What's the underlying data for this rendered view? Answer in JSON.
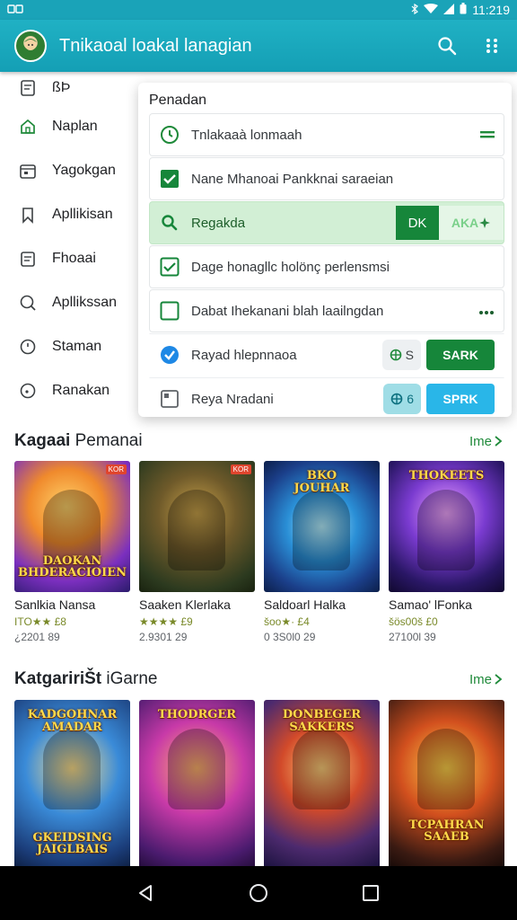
{
  "status_bar": {
    "time": "11:219"
  },
  "app_bar": {
    "title": "Tnikaoal loakal lanagian"
  },
  "side_menu": [
    {
      "label": "ßÞ",
      "icon": "document-icon"
    },
    {
      "label": "Naplan",
      "icon": "home-icon"
    },
    {
      "label": "Yagokgan",
      "icon": "calendar-icon"
    },
    {
      "label": "Apllikisan",
      "icon": "bookmark-icon"
    },
    {
      "label": "Fhoaai",
      "icon": "clipboard-icon"
    },
    {
      "label": "Apllikssan",
      "icon": "chat-icon"
    },
    {
      "label": "Staman",
      "icon": "clock-icon"
    },
    {
      "label": "Ranakan",
      "icon": "info-icon"
    }
  ],
  "panel": {
    "title": "Penadan",
    "rows": [
      {
        "text": "Tnlakaaà lonmaah"
      },
      {
        "text": "Nane Mhanoai Pankknai saraeian"
      },
      {
        "text": "Regakda",
        "ok_label": "DK",
        "ghost_label": "AKA"
      },
      {
        "text": "Dage honagllc holönç perlensmsi"
      },
      {
        "text": "Dabat Ihekanani blah laailngdan"
      },
      {
        "text": "Rayad hlepnnaoa",
        "chip_label": "S",
        "button_label": "SARK"
      },
      {
        "text": "Reya Nradani",
        "chip_label": "6",
        "button_label": "SPRK"
      }
    ]
  },
  "sections": [
    {
      "title_bold": "Kagaai",
      "title_rest": "Pemanai",
      "more_label": "Ime",
      "games": [
        {
          "name": "Sanlkia Nansa",
          "rating": "ITO★★ £8",
          "count": "¿2201 89",
          "thumb_text": "DAOKAN\nBHDERACIOIEN",
          "badge": "KOR"
        },
        {
          "name": "Saaken Klerlaka",
          "rating": "★★★★ £9",
          "count": "2.9301 29",
          "thumb_text": "",
          "badge": "KOR"
        },
        {
          "name": "Saldoarl Halka",
          "rating": "šoo★· £4",
          "count": "0 3S0l0 29",
          "thumb_text": "BKO\nJOUHAR",
          "badge": ""
        },
        {
          "name": "Samao' lFonka",
          "rating": "šös00š £0",
          "count": "27100l 39",
          "thumb_text": "THOKEETS",
          "badge": ""
        }
      ]
    },
    {
      "title_bold": "KatgaririŠt",
      "title_rest": "iGarne",
      "more_label": "Ime",
      "games": [
        {
          "name": "",
          "rating": "",
          "count": "",
          "thumb_text": "KADGOHNAR\nAMADAR",
          "thumb_text_bottom": "GKEIDSING\nJAIGLBAIS",
          "badge": ""
        },
        {
          "name": "",
          "rating": "",
          "count": "",
          "thumb_text": "THODRGER",
          "thumb_text_bottom": "",
          "badge": ""
        },
        {
          "name": "",
          "rating": "",
          "count": "",
          "thumb_text": "DONBEGER\nSAKKERS",
          "thumb_text_bottom": "",
          "badge": ""
        },
        {
          "name": "",
          "rating": "",
          "count": "",
          "thumb_text": "",
          "thumb_text_bottom": "TCPAHRAN\nSAAEB",
          "badge": ""
        }
      ]
    }
  ],
  "colors": {
    "app_bar": "#149fb5",
    "accent_green": "#16863a",
    "accent_blue": "#29b6e8"
  }
}
